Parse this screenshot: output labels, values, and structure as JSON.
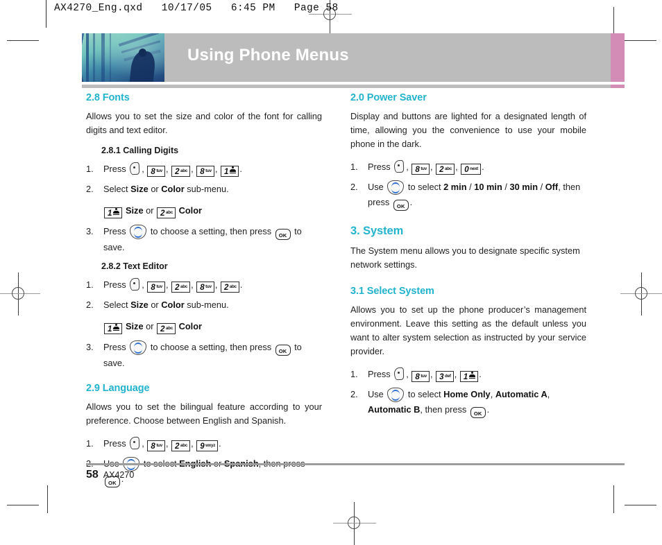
{
  "printer_stamp": "AX4270_Eng.qxd   10/17/05   6:45 PM   Page 58",
  "banner": {
    "title": "Using Phone Menus",
    "gray": "#bcbcbc",
    "accent": "#d38cb6"
  },
  "theme": {
    "heading_color": "#22b3cd",
    "body_color": "#1f1f1f"
  },
  "left_column": {
    "section_fonts": {
      "heading": "2.8 Fonts",
      "intro": "Allows you to set the size and color of the font for calling digits and text editor.",
      "sub1": {
        "heading": "2.8.1 Calling Digits",
        "step1_label": "1.",
        "step1_verb": "Press",
        "step2_label": "2.",
        "step2_text_a": "Select",
        "step2_bold_a": "Size",
        "step2_text_b": "or",
        "step2_bold_b": "Color",
        "step2_text_c": "sub-menu.",
        "choice_size": "Size",
        "choice_or": "or",
        "choice_color": "Color",
        "step3_label": "3.",
        "step3_verb": "Press",
        "step3_text_a": "to choose a setting, then press",
        "step3_text_b": "to save."
      },
      "sub2": {
        "heading": "2.8.2 Text Editor",
        "step1_label": "1.",
        "step1_verb": "Press",
        "step2_label": "2.",
        "step2_text_a": "Select",
        "step2_bold_a": "Size",
        "step2_text_b": "or",
        "step2_bold_b": "Color",
        "step2_text_c": "sub-menu.",
        "choice_size": "Size",
        "choice_or": "or",
        "choice_color": "Color",
        "step3_label": "3.",
        "step3_verb": "Press",
        "step3_text_a": "to choose a setting, then press",
        "step3_text_b": "to save."
      }
    },
    "section_language": {
      "heading": "2.9 Language",
      "intro": "Allows you to set the bilingual feature according to your preference. Choose between English and Spanish.",
      "step1_label": "1.",
      "step1_verb": "Press",
      "step2_label": "2.",
      "step2_verb": "Use",
      "step2_text_a": "to select",
      "step2_bold_a": "English",
      "step2_text_b": "or",
      "step2_bold_b": "Spanish",
      "step2_text_c": ", then press",
      "step2_text_d": "."
    }
  },
  "right_column": {
    "section_power_saver": {
      "heading": "2.0 Power Saver",
      "intro": "Display and buttons are lighted for a designated length of time, allowing you the convenience to use your mobile phone in the dark.",
      "step1_label": "1.",
      "step1_verb": "Press",
      "step2_label": "2.",
      "step2_verb": "Use",
      "step2_text_a": "to select",
      "step2_opt1": "2 min",
      "step2_sep1": "/",
      "step2_opt2": "10 min",
      "step2_sep2": "/",
      "step2_opt3": "30 min",
      "step2_sep3": "/",
      "step2_opt4": "Off",
      "step2_text_b": ", then press",
      "step2_text_c": "."
    },
    "section_system": {
      "heading": "3. System",
      "intro": "The System menu allows you to designate specific system network settings."
    },
    "section_select_system": {
      "heading": "3.1 Select System",
      "intro": "Allows you to set up the phone producer’s management environment. Leave this setting as the default unless you want to alter system selection as instructed by your service provider.",
      "step1_label": "1.",
      "step1_verb": "Press",
      "step2_label": "2.",
      "step2_verb": "Use",
      "step2_text_a": "to select",
      "step2_opt1": "Home Only",
      "step2_sep1": ",",
      "step2_opt2": "Automatic A",
      "step2_sep2": ",",
      "step2_opt3": "Automatic B",
      "step2_text_b": ", then press",
      "step2_text_c": "."
    }
  },
  "keys": {
    "menu": "menu-key",
    "nav": "navigation-key",
    "ok": "OK",
    "k8": {
      "num": "8",
      "sup": "tuv"
    },
    "k2": {
      "num": "2",
      "sup": "abc"
    },
    "k1": {
      "num": "1",
      "sup": ""
    },
    "k9": {
      "num": "9",
      "sup": "wxyz"
    },
    "k0": {
      "num": "0",
      "sup": "next"
    },
    "k3": {
      "num": "3",
      "sup": "def"
    }
  },
  "footer": {
    "page_number": "58",
    "model": "AX4270"
  }
}
